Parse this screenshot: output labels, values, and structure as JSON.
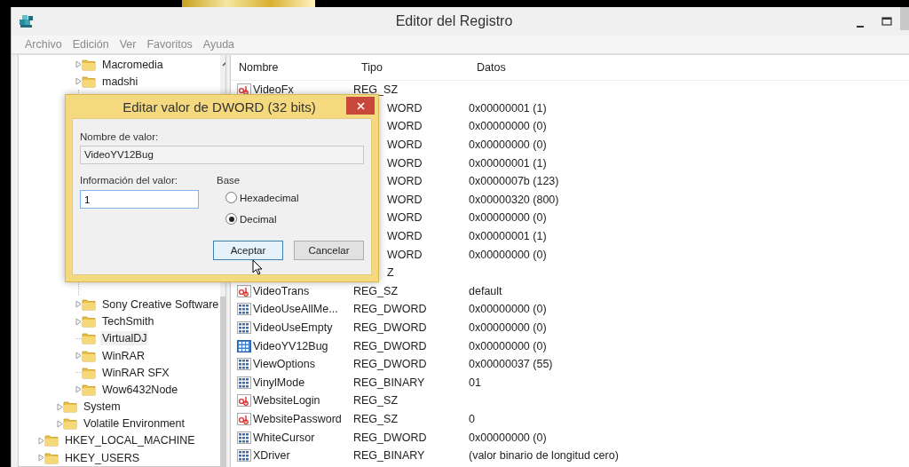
{
  "window": {
    "title": "Editor del Registro"
  },
  "menu": [
    "Archivo",
    "Edición",
    "Ver",
    "Favoritos",
    "Ayuda"
  ],
  "tree": {
    "items": [
      {
        "children": [
          {
            "children": [
              {
                "label": "Macromedia",
                "expandable": true,
                "selected": false
              },
              {
                "label": "madshi",
                "expandable": true,
                "selected": false,
                "gap_after": true
              },
              {
                "label": "Sony Creative Software",
                "expandable": true,
                "selected": false
              },
              {
                "label": "TechSmith",
                "expandable": true,
                "selected": false
              },
              {
                "label": "VirtualDJ",
                "expandable": false,
                "selected": true
              },
              {
                "label": "WinRAR",
                "expandable": true,
                "selected": false
              },
              {
                "label": "WinRAR SFX",
                "expandable": false,
                "selected": false
              },
              {
                "label": "Wow6432Node",
                "expandable": true,
                "selected": false
              }
            ]
          },
          {
            "label": "System",
            "expandable": true,
            "selected": false
          },
          {
            "label": "Volatile Environment",
            "expandable": true,
            "selected": false
          }
        ]
      },
      {
        "label": "HKEY_LOCAL_MACHINE",
        "expandable": true,
        "selected": false
      },
      {
        "label": "HKEY_USERS",
        "expandable": true,
        "selected": false
      }
    ]
  },
  "list": {
    "columns": [
      "Nombre",
      "Tipo",
      "Datos"
    ],
    "rows": [
      {
        "kind": "string",
        "name": "VideoFx",
        "type": "REG_SZ",
        "selected": false
      },
      {
        "type": "WORD",
        "data": "0x00000001 (1)"
      },
      {
        "type": "WORD",
        "data": "0x00000000 (0)"
      },
      {
        "type": "WORD",
        "data": "0x00000000 (0)"
      },
      {
        "type": "WORD",
        "data": "0x00000001 (1)"
      },
      {
        "type": "WORD",
        "data": "0x0000007b (123)"
      },
      {
        "type": "WORD",
        "data": "0x00000320 (800)"
      },
      {
        "type": "WORD",
        "data": "0x00000000 (0)"
      },
      {
        "type": "WORD",
        "data": "0x00000001 (1)"
      },
      {
        "type": "WORD",
        "data": "0x00000000 (0)"
      },
      {
        "type": "Z"
      },
      {
        "kind": "string",
        "name": "VideoTrans",
        "type": "REG_SZ",
        "data": "default",
        "selected": false
      },
      {
        "kind": "binary",
        "name": "VideoUseAllMe...",
        "type": "REG_DWORD",
        "data": "0x00000000 (0)",
        "selected": false
      },
      {
        "kind": "binary",
        "name": "VideoUseEmpty",
        "type": "REG_DWORD",
        "data": "0x00000000 (0)",
        "selected": false
      },
      {
        "kind": "binary",
        "name": "VideoYV12Bug",
        "type": "REG_DWORD",
        "data": "0x00000000 (0)",
        "selected": true
      },
      {
        "kind": "binary",
        "name": "ViewOptions",
        "type": "REG_DWORD",
        "data": "0x00000037 (55)",
        "selected": false
      },
      {
        "kind": "binary",
        "name": "VinylMode",
        "type": "REG_BINARY",
        "data": "01",
        "selected": false
      },
      {
        "kind": "string",
        "name": "WebsiteLogin",
        "type": "REG_SZ",
        "selected": false
      },
      {
        "kind": "string",
        "name": "WebsitePassword",
        "type": "REG_SZ",
        "data": "0",
        "selected": false
      },
      {
        "kind": "binary",
        "name": "WhiteCursor",
        "type": "REG_DWORD",
        "data": "0x00000000 (0)",
        "selected": false
      },
      {
        "kind": "binary",
        "name": "XDriver",
        "type": "REG_BINARY",
        "data": "(valor binario de longitud cero)",
        "selected": false
      }
    ]
  },
  "dialog": {
    "title": "Editar valor de DWORD (32 bits)",
    "name_label": "Nombre de valor:",
    "name_value": "VideoYV12Bug",
    "value_label": "Información del valor:",
    "value": "1",
    "base_label": "Base",
    "base_options": [
      {
        "label": "Hexadecimal",
        "selected": false
      },
      {
        "label": "Decimal",
        "selected": true
      }
    ],
    "buttons": [
      {
        "label": "Aceptar",
        "default": true
      },
      {
        "label": "Cancelar",
        "default": false
      }
    ]
  }
}
